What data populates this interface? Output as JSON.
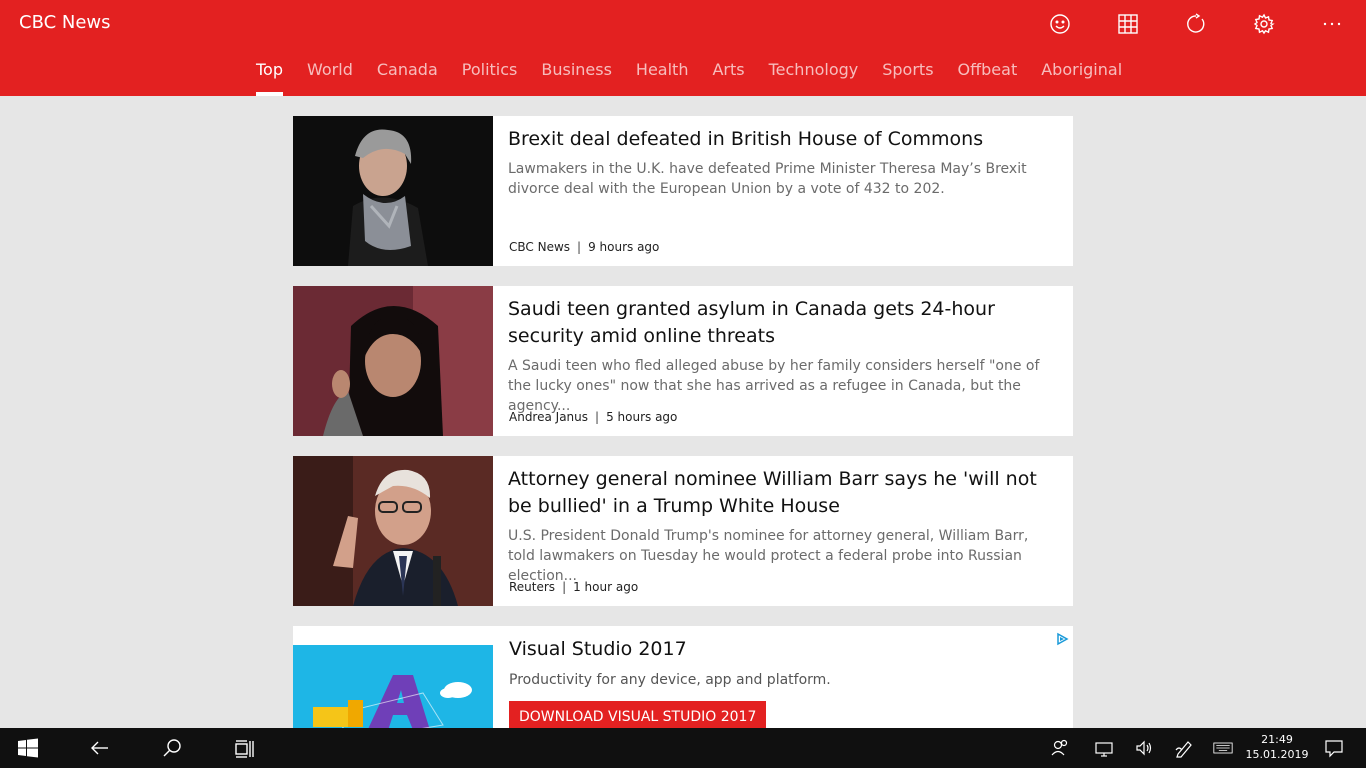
{
  "app": {
    "title": "CBC News"
  },
  "header_icons": [
    "smiley-icon",
    "grid-icon",
    "refresh-icon",
    "settings-icon",
    "more-icon"
  ],
  "tabs": [
    {
      "label": "Top",
      "active": true
    },
    {
      "label": "World"
    },
    {
      "label": "Canada"
    },
    {
      "label": "Politics"
    },
    {
      "label": "Business"
    },
    {
      "label": "Health"
    },
    {
      "label": "Arts"
    },
    {
      "label": "Technology"
    },
    {
      "label": "Sports"
    },
    {
      "label": "Offbeat"
    },
    {
      "label": "Aboriginal"
    }
  ],
  "articles": [
    {
      "title": "Brexit deal defeated in British House of Commons",
      "summary": "Lawmakers in the U.K. have defeated Prime Minister Theresa May’s Brexit divorce deal with the European Union by a vote of 432 to 202.",
      "source": "CBC News",
      "time": "9 hours ago"
    },
    {
      "title": "Saudi teen granted asylum in Canada gets 24-hour security amid online threats",
      "summary": "A Saudi teen who fled alleged abuse by her family considers herself \"one of the lucky ones\" now that she has arrived as a refugee in Canada, but the agency...",
      "source": "Andrea Janus",
      "time": "5 hours ago"
    },
    {
      "title": "Attorney general nominee William Barr says he 'will not be bullied' in a Trump White House",
      "summary": "U.S. President Donald Trump's nominee for attorney general, William Barr, told lawmakers on Tuesday he would protect a federal probe into Russian election...",
      "source": "Reuters",
      "time": "1 hour ago"
    }
  ],
  "ad": {
    "title": "Visual Studio 2017",
    "subtitle": "Productivity for any device, app and platform.",
    "button": "DOWNLOAD VISUAL STUDIO 2017"
  },
  "taskbar": {
    "time": "21:49",
    "date": "15.01.2019"
  },
  "colors": {
    "brand": "#e32121",
    "background": "#e6e6e6",
    "taskbar": "#101010"
  }
}
